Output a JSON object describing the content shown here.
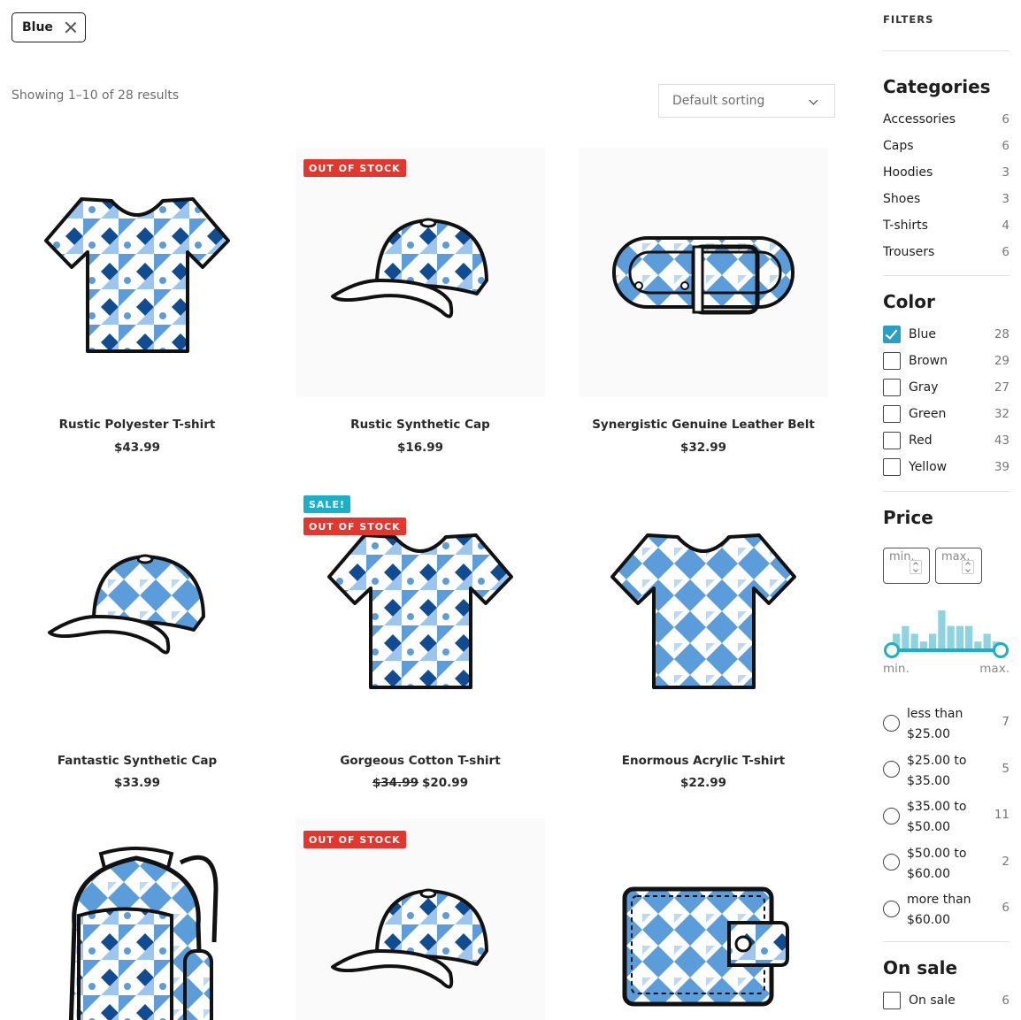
{
  "active_filter": {
    "label": "Blue"
  },
  "toolbar": {
    "result_count": "Showing 1–10 of 28 results",
    "sorting": "Default sorting"
  },
  "products": [
    {
      "name": "Rustic Polyester T-shirt",
      "price": "$43.99",
      "old_price": "",
      "badges": []
    },
    {
      "name": "Rustic Synthetic Cap",
      "price": "$16.99",
      "old_price": "",
      "badges": [
        "OUT OF STOCK"
      ]
    },
    {
      "name": "Synergistic Genuine Leather Belt",
      "price": "$32.99",
      "old_price": "",
      "badges": []
    },
    {
      "name": "Fantastic Synthetic Cap",
      "price": "$33.99",
      "old_price": "",
      "badges": []
    },
    {
      "name": "Gorgeous Cotton T-shirt",
      "price": "$20.99",
      "old_price": "$34.99",
      "badges": [
        "SALE!",
        "OUT OF STOCK"
      ]
    },
    {
      "name": "Enormous Acrylic T-shirt",
      "price": "$22.99",
      "old_price": "",
      "badges": []
    },
    {
      "name": "",
      "price": "",
      "old_price": "",
      "badges": []
    },
    {
      "name": "",
      "price": "",
      "old_price": "",
      "badges": [
        "OUT OF STOCK"
      ]
    },
    {
      "name": "",
      "price": "",
      "old_price": "",
      "badges": []
    }
  ],
  "sidebar": {
    "title": "FILTERS",
    "categories": {
      "title": "Categories",
      "items": [
        {
          "label": "Accessories",
          "count": "6"
        },
        {
          "label": "Caps",
          "count": "6"
        },
        {
          "label": "Hoodies",
          "count": "3"
        },
        {
          "label": "Shoes",
          "count": "3"
        },
        {
          "label": "T-shirts",
          "count": "4"
        },
        {
          "label": "Trousers",
          "count": "6"
        }
      ]
    },
    "color": {
      "title": "Color",
      "items": [
        {
          "label": "Blue",
          "count": "28",
          "checked": true
        },
        {
          "label": "Brown",
          "count": "29",
          "checked": false
        },
        {
          "label": "Gray",
          "count": "27",
          "checked": false
        },
        {
          "label": "Green",
          "count": "32",
          "checked": false
        },
        {
          "label": "Red",
          "count": "43",
          "checked": false
        },
        {
          "label": "Yellow",
          "count": "39",
          "checked": false
        }
      ]
    },
    "price": {
      "title": "Price",
      "min_placeholder": "min.",
      "max_placeholder": "max.",
      "slider_min_label": "min.",
      "slider_max_label": "max.",
      "histogram": [
        2,
        3,
        2,
        1,
        2,
        5,
        3,
        3,
        3,
        1,
        2,
        1
      ],
      "ranges": [
        {
          "line1": "less than",
          "line2": "$25.00",
          "count": "7"
        },
        {
          "line1": "$25.00 to",
          "line2": "$35.00",
          "count": "5"
        },
        {
          "line1": "$35.00 to",
          "line2": "$50.00",
          "count": "11"
        },
        {
          "line1": "$50.00 to",
          "line2": "$60.00",
          "count": "2"
        },
        {
          "line1": "more than",
          "line2": "$60.00",
          "count": "6"
        }
      ]
    },
    "on_sale": {
      "title": "On sale",
      "items": [
        {
          "label": "On sale",
          "count": "6",
          "checked": false
        }
      ]
    }
  },
  "colors": {
    "accent": "#2a9fc6",
    "teal": "#1ab0c7",
    "oos_red": "#e5362d",
    "pattern_light": "#5b9ddb",
    "pattern_dark": "#0f4c92"
  }
}
